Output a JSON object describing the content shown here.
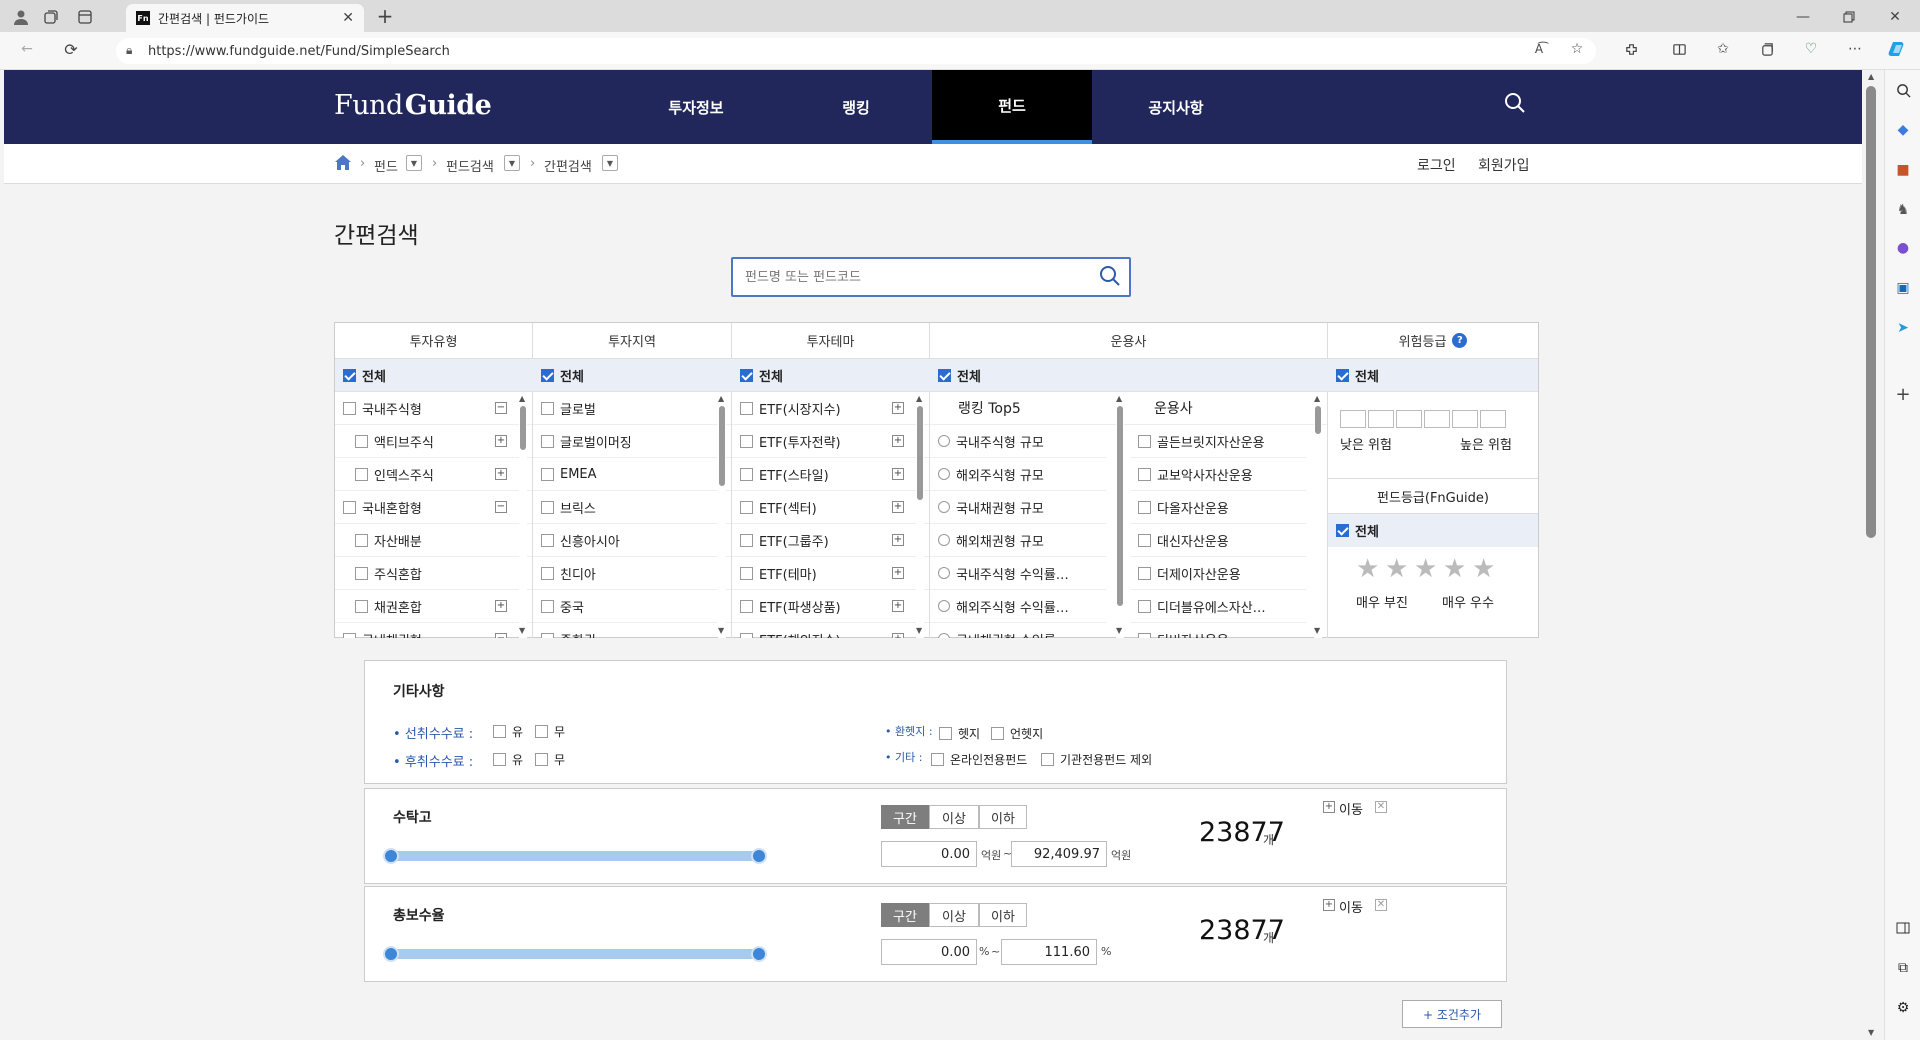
{
  "browser": {
    "tab_title": "간편검색 | 펀드가이드",
    "tab_favicon": "Fn",
    "url": "https://www.fundguide.net/Fund/SimpleSearch"
  },
  "site": {
    "logo_part1": "Fund",
    "logo_part2": "Guide",
    "nav": [
      "투자정보",
      "랭킹",
      "펀드",
      "공지사항"
    ],
    "breadcrumb": [
      "펀드",
      "펀드검색",
      "간편검색"
    ],
    "login": "로그인",
    "signup": "회원가입"
  },
  "page": {
    "title": "간편검색",
    "search_placeholder": "펀드명 또는 펀드코드"
  },
  "filter": {
    "headers": [
      "투자유형",
      "투자지역",
      "투자테마",
      "운용사",
      "위험등급"
    ],
    "all_label": "전체",
    "invest_type": [
      {
        "label": "국내주식형",
        "indent": false,
        "toggle": "−"
      },
      {
        "label": "액티브주식",
        "indent": true,
        "toggle": "+"
      },
      {
        "label": "인덱스주식",
        "indent": true,
        "toggle": "+"
      },
      {
        "label": "국내혼합형",
        "indent": false,
        "toggle": "−"
      },
      {
        "label": "자산배분",
        "indent": true,
        "toggle": ""
      },
      {
        "label": "주식혼합",
        "indent": true,
        "toggle": ""
      },
      {
        "label": "채권혼합",
        "indent": true,
        "toggle": "+"
      },
      {
        "label": "국내채권형",
        "indent": false,
        "toggle": "−"
      }
    ],
    "invest_region": [
      "글로벌",
      "글로벌이머징",
      "EMEA",
      "브릭스",
      "신흥아시아",
      "친디아",
      "중국",
      "중화권"
    ],
    "invest_theme": [
      "ETF(시장지수)",
      "ETF(투자전략)",
      "ETF(스타일)",
      "ETF(섹터)",
      "ETF(그룹주)",
      "ETF(테마)",
      "ETF(파생상품)",
      "ETF(해외지수)"
    ],
    "manager_rank_title": "랭킹 Top5",
    "manager_rank": [
      "국내주식형 규모",
      "해외주식형 규모",
      "국내채권형 규모",
      "해외채권형 규모",
      "국내주식형 수익률…",
      "해외주식형 수익률…",
      "국내채권형 수익률…"
    ],
    "manager_list_title": "운용사",
    "manager_list": [
      "골든브릿지자산운용",
      "교보악사자산운용",
      "다올자산운용",
      "대신자산운용",
      "더제이자산운용",
      "디더블유에스자산…",
      "디비자산운용"
    ],
    "risk_low": "낮은 위험",
    "risk_high": "높은 위험",
    "fund_grade_title": "펀드등급(FnGuide)",
    "grade_low": "매우 부진",
    "grade_high": "매우 우수"
  },
  "etc": {
    "title": "기타사항",
    "front_fee": "선취수수료 :",
    "back_fee": "후취수수료 :",
    "yes": "유",
    "no": "무",
    "hedge_label": "환헷지 :",
    "hedge": "헷지",
    "unhedge": "언헷지",
    "other_label": "기타 :",
    "online": "온라인전용펀드",
    "institution": "기관전용펀드 제외"
  },
  "aum": {
    "title": "수탁고",
    "seg": [
      "구간",
      "이상",
      "이하"
    ],
    "min": "0.00",
    "max": "92,409.97",
    "unit": "억원",
    "tilde": "~",
    "count": "23877",
    "count_unit": "개",
    "move": "이동"
  },
  "fee": {
    "title": "총보수율",
    "seg": [
      "구간",
      "이상",
      "이하"
    ],
    "min": "0.00",
    "max": "111.60",
    "unit": "%",
    "tilde": "~",
    "count": "23877",
    "count_unit": "개",
    "move": "이동"
  },
  "add_condition": "+ 조건추가"
}
